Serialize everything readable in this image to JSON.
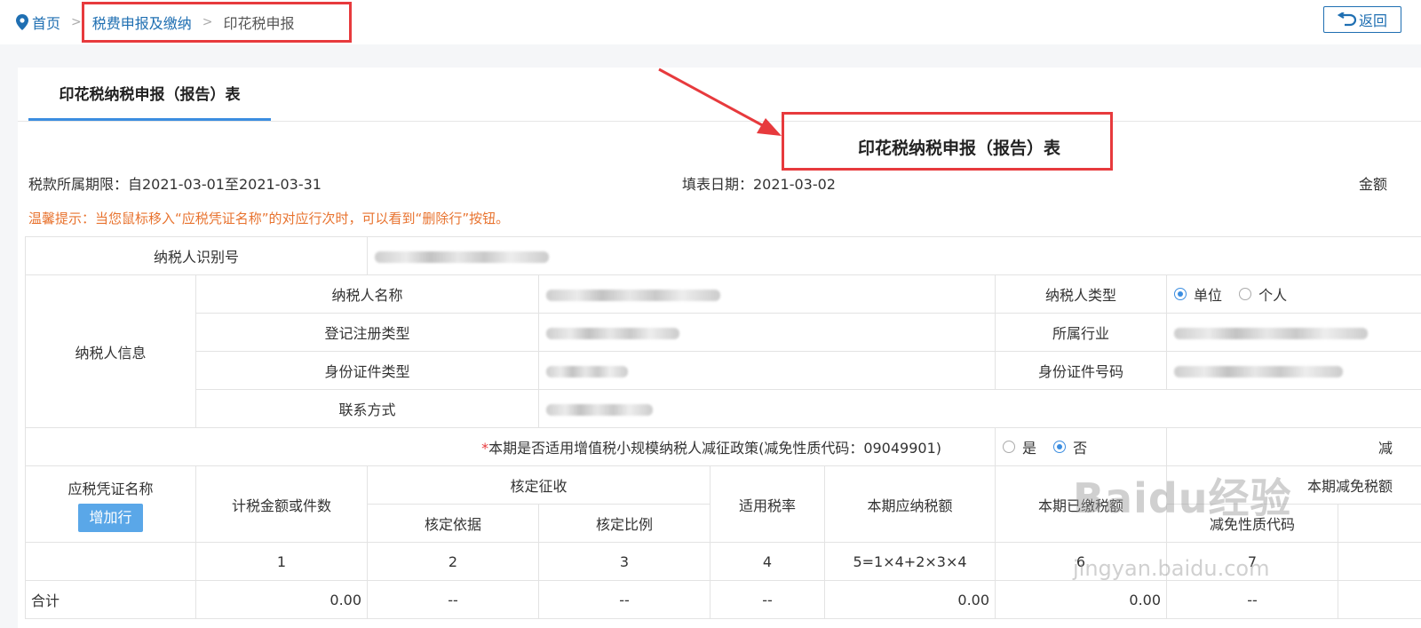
{
  "breadcrumb": {
    "home": "首页",
    "mid": "税费申报及缴纳",
    "current": "印花税申报",
    "separator": ">"
  },
  "back_label": "返回",
  "tab_label": "印花税纳税申报（报告）表",
  "form_title": "印花税纳税申报（报告）表",
  "period_text": "税款所属期限：自2021-03-01至2021-03-31",
  "fill_date_text": "填表日期：2021-03-02",
  "amount_unit_text": "金额",
  "warning_text": "温馨提示：当您鼠标移入“应税凭证名称”的对应行次时，可以看到“删除行”按钮。",
  "taxpayer": {
    "id_label": "纳税人识别号",
    "info_label": "纳税人信息",
    "name_label": "纳税人名称",
    "type_label": "纳税人类型",
    "type_options": [
      "单位",
      "个人"
    ],
    "type_selected": "单位",
    "reg_type_label": "登记注册类型",
    "industry_label": "所属行业",
    "id_type_label": "身份证件类型",
    "id_no_label": "身份证件号码",
    "contact_label": "联系方式"
  },
  "policy": {
    "required_mark": "*",
    "label": "本期是否适用增值税小规模纳税人减征政策(减免性质代码：09049901)",
    "options": [
      "是",
      "否"
    ],
    "selected": "否",
    "right_label": "减"
  },
  "table": {
    "col_name": "应税凭证名称",
    "add_row": "增加行",
    "col_amount": "计税金额或件数",
    "col_assess": "核定征收",
    "col_basis": "核定依据",
    "col_ratio": "核定比例",
    "col_rate": "适用税率",
    "col_payable": "本期应纳税额",
    "col_paid": "本期已缴税额",
    "col_reduce": "本期减免税额",
    "col_reduce_code": "减免性质代码",
    "idx": [
      "1",
      "2",
      "3",
      "4",
      "5=1×4+2×3×4",
      "6",
      "7"
    ],
    "total_row": {
      "label": "合计",
      "amount": "0.00",
      "basis": "--",
      "ratio": "--",
      "rate": "--",
      "payable": "0.00",
      "paid": "0.00",
      "reduce_code": "--"
    }
  },
  "watermark": {
    "main": "Baidu经验",
    "sub": "jingyan.baidu.com"
  },
  "colors": {
    "link": "#1f6fb2",
    "annotation_red": "#e73a3d",
    "warning": "#e8732f",
    "accent": "#3b8de0",
    "add_button": "#5aa7e8"
  }
}
